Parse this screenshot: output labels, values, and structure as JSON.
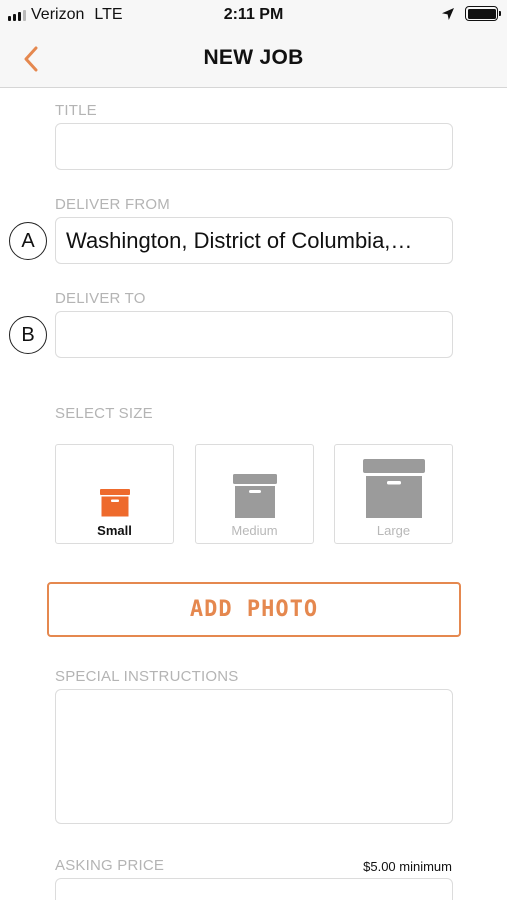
{
  "status_bar": {
    "carrier": "Verizon",
    "network": "LTE",
    "time": "2:11 PM",
    "signal_bars_filled": 3,
    "signal_bars_total": 4,
    "battery_level": 1.0,
    "icons": [
      "location-arrow-icon",
      "battery-icon"
    ]
  },
  "nav": {
    "title": "NEW JOB",
    "back_icon": "chevron-left-icon",
    "accent_color": "#e5884f"
  },
  "form": {
    "title": {
      "label": "TITLE",
      "value": ""
    },
    "deliver_from": {
      "label": "DELIVER FROM",
      "value": "Washington, District of Columbia,…",
      "marker": "A"
    },
    "deliver_to": {
      "label": "DELIVER TO",
      "value": "",
      "marker": "B"
    },
    "select_size": {
      "label": "SELECT SIZE",
      "options": [
        {
          "label": "Small",
          "selected": true,
          "icon": "box-icon",
          "color": "#ee6a2c"
        },
        {
          "label": "Medium",
          "selected": false,
          "icon": "box-icon",
          "color": "#9b9b9b"
        },
        {
          "label": "Large",
          "selected": false,
          "icon": "box-icon",
          "color": "#9b9b9b"
        }
      ]
    },
    "add_photo": {
      "label": "ADD PHOTO"
    },
    "special_instructions": {
      "label": "SPECIAL INSTRUCTIONS",
      "value": ""
    },
    "asking_price": {
      "label": "ASKING PRICE",
      "note": "$5.00 minimum",
      "value": ""
    }
  }
}
